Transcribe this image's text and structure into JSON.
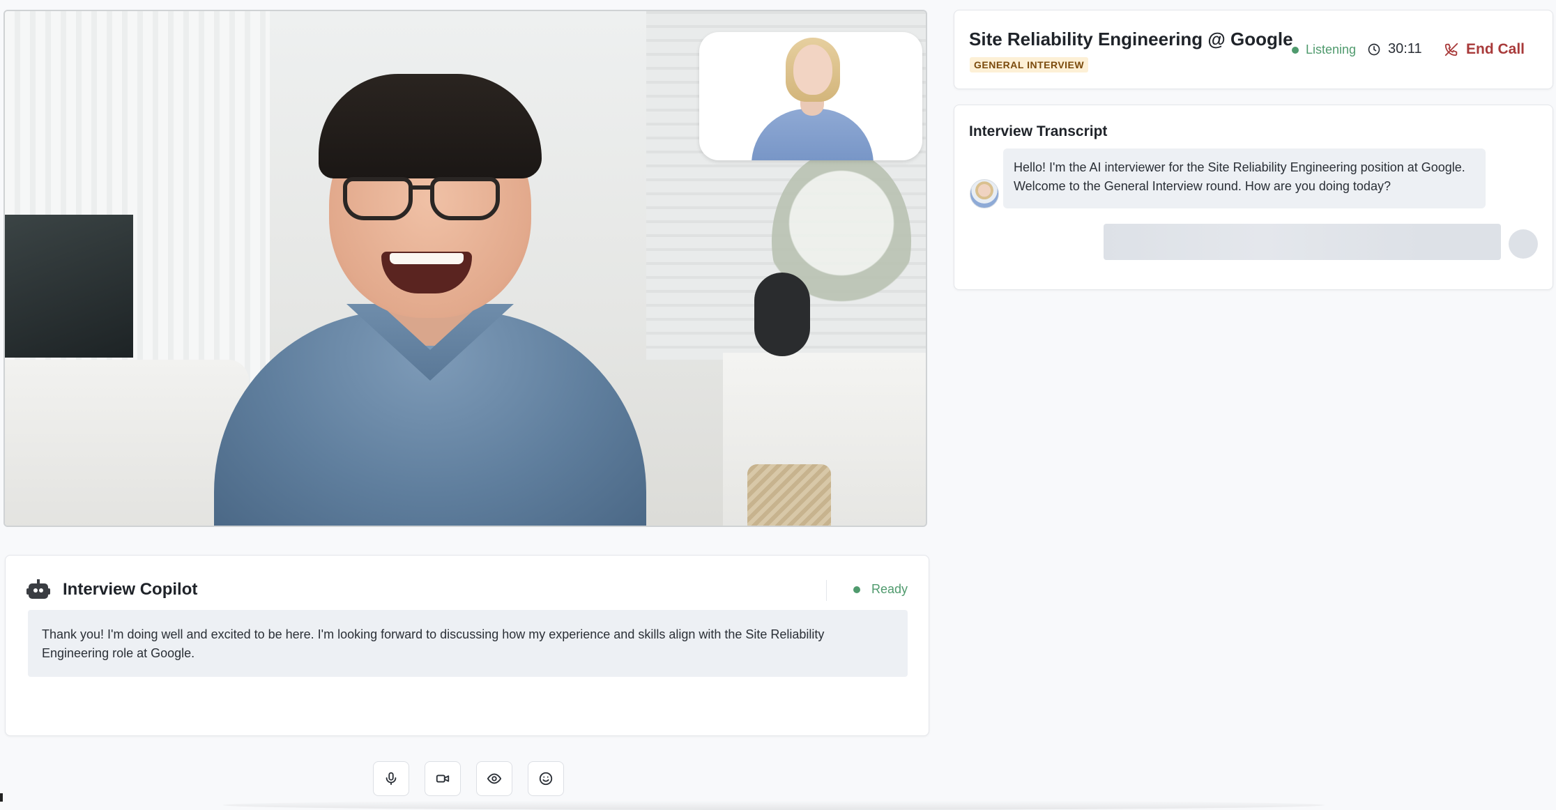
{
  "header": {
    "job_title": "Site Reliability Engineering @ Google",
    "round_badge": "GENERAL INTERVIEW",
    "status": "Listening",
    "timer": "30:11",
    "end_call_label": "End Call",
    "status_color": "#4f9a6d",
    "end_call_color": "#a83a3a"
  },
  "video": {
    "candidate_icon": "candidate-video-feed",
    "interviewer_icon": "interviewer-avatar-video"
  },
  "copilot": {
    "title": "Interview Copilot",
    "status": "Ready",
    "suggestion": "Thank you! I'm doing well and excited to be here. I'm looking forward to discussing how my experience and skills align with the Site Reliability Engineering role at Google."
  },
  "controls": [
    {
      "icon": "microphone-icon"
    },
    {
      "icon": "video-camera-icon"
    },
    {
      "icon": "eye-icon"
    },
    {
      "icon": "smiley-face-icon"
    }
  ],
  "transcript": {
    "title": "Interview Transcript",
    "messages": [
      {
        "speaker": "ai",
        "text": "Hello! I'm the AI interviewer for the Site Reliability Engineering position at Google. Welcome to the General Interview round. How are you doing today?"
      },
      {
        "speaker": "user",
        "text": ""
      }
    ]
  }
}
